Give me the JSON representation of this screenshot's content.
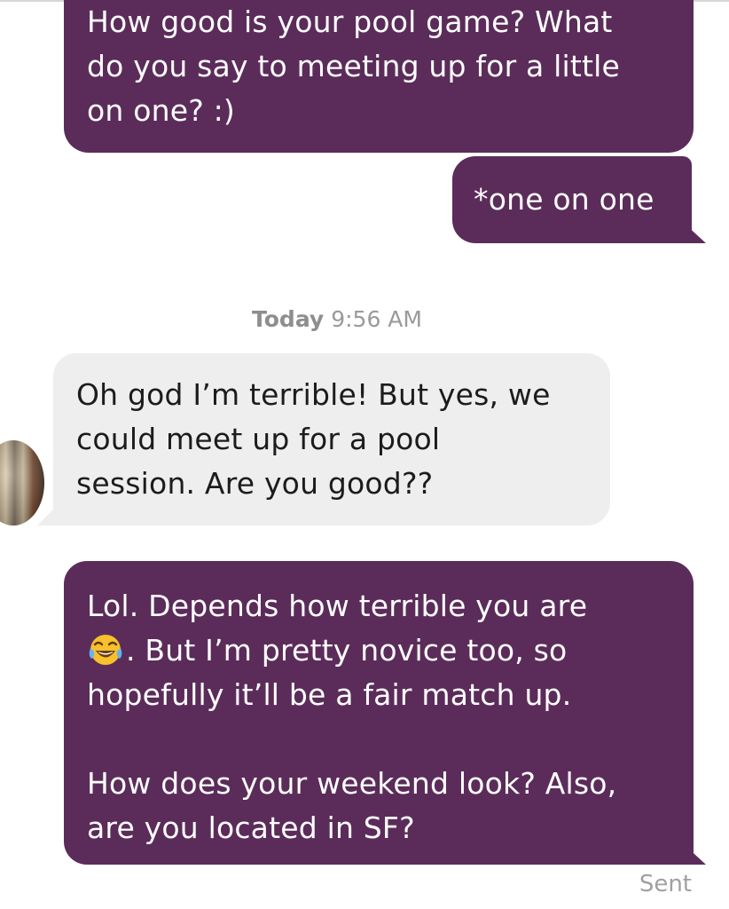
{
  "colors": {
    "outgoing_bubble": "#5b2c5a",
    "incoming_bubble": "#eeeeee",
    "timestamp_text": "#9a9a9a"
  },
  "messages": [
    {
      "direction": "outgoing",
      "lines": [
        "How good is your pool game? What",
        "do you say to meeting up for a little",
        "on one? :)"
      ]
    },
    {
      "direction": "outgoing",
      "lines": [
        "*one on one"
      ]
    },
    {
      "direction": "incoming",
      "lines": [
        "Oh god I’m terrible! But yes, we",
        "could meet up for a pool",
        "session. Are you good??"
      ]
    },
    {
      "direction": "outgoing",
      "lines": [
        "Lol. Depends how terrible you are",
        ". But I’m pretty novice too, so",
        "hopefully it’ll be a fair match up.",
        "How does your weekend look? Also,",
        "are you located in SF?"
      ],
      "emoji": "face-with-tears-of-joy-icon"
    }
  ],
  "timestamp": {
    "day": "Today",
    "time": "9:56 AM"
  },
  "delivery_status": "Sent"
}
